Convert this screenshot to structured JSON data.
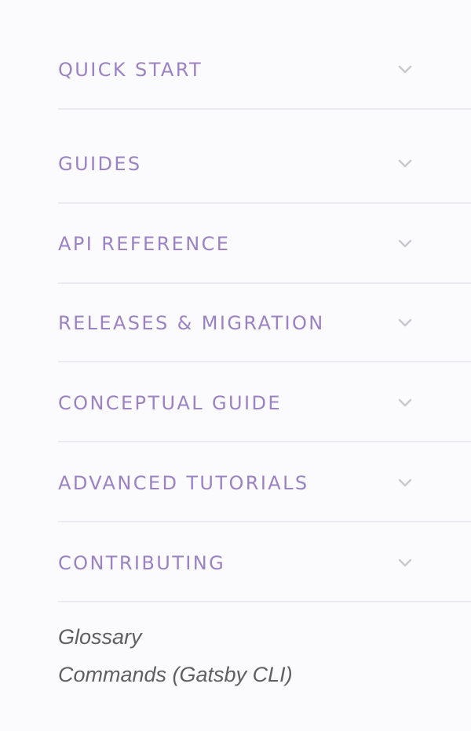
{
  "nav": {
    "sections": [
      {
        "label": "QUICK START"
      },
      {
        "label": "GUIDES"
      },
      {
        "label": "API REFERENCE"
      },
      {
        "label": "RELEASES & MIGRATION"
      },
      {
        "label": "CONCEPTUAL GUIDE"
      },
      {
        "label": "ADVANCED TUTORIALS"
      },
      {
        "label": "CONTRIBUTING"
      }
    ],
    "links": [
      {
        "label": "Glossary"
      },
      {
        "label": "Commands (Gatsby CLI)"
      }
    ]
  },
  "colors": {
    "section_text": "#9b82c3",
    "chevron": "#c8c8cc",
    "link_text": "#5f5f5f",
    "divider": "#eceaf0",
    "background": "#fbfafd"
  },
  "icons": {
    "expand": "chevron-down-icon"
  }
}
